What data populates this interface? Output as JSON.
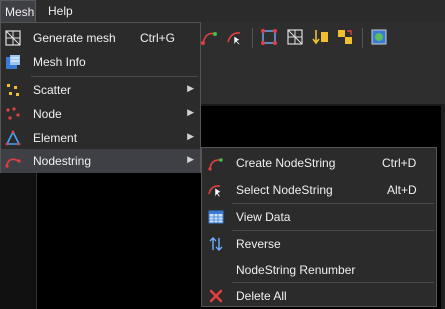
{
  "menubar": {
    "items": [
      "Mesh",
      "Help"
    ]
  },
  "mesh_menu": {
    "items": [
      {
        "label": "Generate mesh",
        "shortcut": "Ctrl+G",
        "icon": "grid-icon"
      },
      {
        "label": "Mesh Info",
        "icon": "info-table-icon"
      },
      {
        "label": "Scatter",
        "icon": "scatter-icon",
        "submenu": true
      },
      {
        "label": "Node",
        "icon": "node-icon",
        "submenu": true
      },
      {
        "label": "Element",
        "icon": "triangle-element-icon",
        "submenu": true
      },
      {
        "label": "Nodestring",
        "icon": "nodestring-icon",
        "submenu": true,
        "highlighted": true
      }
    ]
  },
  "nodestring_submenu": {
    "items": [
      {
        "label": "Create NodeString",
        "shortcut": "Ctrl+D",
        "icon": "create-nodestring-icon"
      },
      {
        "label": "Select NodeString",
        "shortcut": "Alt+D",
        "icon": "select-nodestring-icon"
      },
      {
        "label": "View Data",
        "icon": "table-view-icon"
      },
      {
        "label": "Reverse",
        "icon": "reverse-arrows-icon"
      },
      {
        "label": "NodeString Renumber",
        "icon": ""
      },
      {
        "label": "Delete All",
        "icon": "delete-x-icon"
      }
    ]
  },
  "colors": {
    "menu_bg": "#2b2b2b",
    "highlight": "#3f3f46",
    "accent_red": "#e04040"
  }
}
